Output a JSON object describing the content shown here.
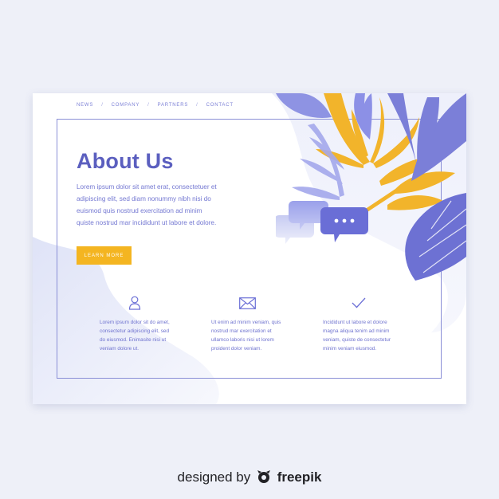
{
  "nav": {
    "items": [
      "NEWS",
      "COMPANY",
      "PARTNERS",
      "CONTACT"
    ],
    "separator": "/"
  },
  "hero": {
    "title": "About Us",
    "intro_lines": [
      "Lorem ipsum dolor sit amet erat, consectetuer et",
      "adipiscing elit, sed diam nonummy nibh nisi do",
      "euismod quis nostrud exercitation ad minim",
      "quiste nostrud mar incididunt ut labore et dolore."
    ],
    "button_label": "LEARN MORE"
  },
  "features": [
    {
      "icon": "user-icon",
      "lines": [
        "Lorem ipsum dolor sit do amet,",
        "consectetur adipiscing elit, sed",
        "do eiusmod. Enimasite nisi ut",
        "veniam dolore ut."
      ]
    },
    {
      "icon": "envelope-icon",
      "lines": [
        "Ut enim ad minim veniam, quis",
        "nostrud mar exercitation et",
        "ullamco laboris nisi ut lorem",
        "proident dolor veniam."
      ]
    },
    {
      "icon": "checkmark-icon",
      "lines": [
        "Incididunt ut labore et dolore",
        "magna aliqua tenim ad minim",
        "veniam, quiste de consectetur",
        "minim veniam eiusmod."
      ]
    }
  ],
  "credit": {
    "prefix": "designed by",
    "brand": "freepik"
  },
  "colors": {
    "primary": "#5b5fbf",
    "accent": "#f4b521",
    "text": "#7478d2",
    "background": "#eef0f8"
  }
}
